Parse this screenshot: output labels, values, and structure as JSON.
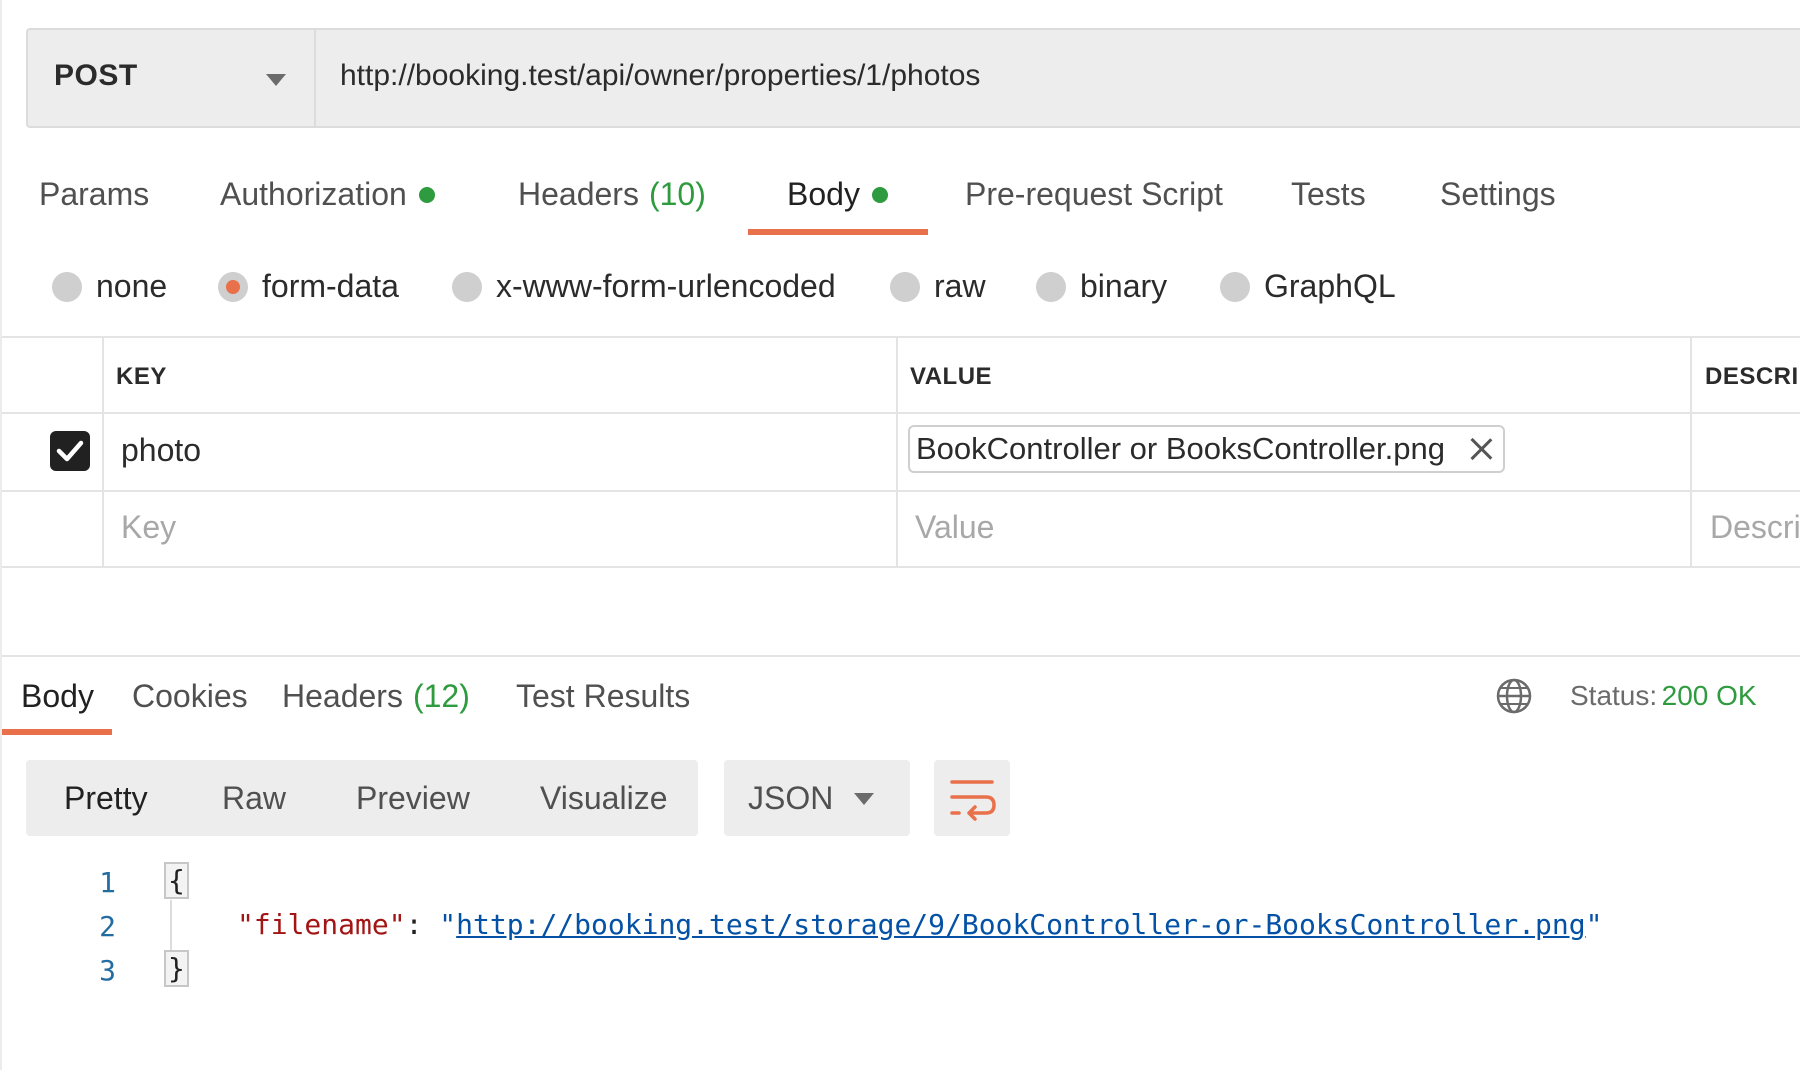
{
  "request": {
    "method": "POST",
    "url": "http://booking.test/api/owner/properties/1/photos"
  },
  "request_tabs": [
    {
      "label": "Params"
    },
    {
      "label": "Authorization",
      "dot": true
    },
    {
      "label": "Headers",
      "count": "(10)"
    },
    {
      "label": "Body",
      "dot": true,
      "active": true
    },
    {
      "label": "Pre-request Script"
    },
    {
      "label": "Tests"
    },
    {
      "label": "Settings"
    }
  ],
  "body_types": [
    {
      "label": "none"
    },
    {
      "label": "form-data",
      "checked": true
    },
    {
      "label": "x-www-form-urlencoded"
    },
    {
      "label": "raw"
    },
    {
      "label": "binary"
    },
    {
      "label": "GraphQL"
    }
  ],
  "params_table": {
    "headers": {
      "key": "KEY",
      "value": "VALUE",
      "description": "DESCRIPTION"
    },
    "rows": [
      {
        "checked": true,
        "key": "photo",
        "value_file": "BookController or BooksController.png"
      }
    ],
    "new_row": {
      "key_placeholder": "Key",
      "value_placeholder": "Value",
      "description_placeholder": "Description"
    }
  },
  "response_tabs": [
    {
      "label": "Body",
      "active": true
    },
    {
      "label": "Cookies"
    },
    {
      "label": "Headers",
      "count": "(12)"
    },
    {
      "label": "Test Results"
    }
  ],
  "status": {
    "label": "Status:",
    "value": "200 OK",
    "icon": "globe-icon"
  },
  "view_modes": [
    {
      "label": "Pretty",
      "active": true
    },
    {
      "label": "Raw"
    },
    {
      "label": "Preview"
    },
    {
      "label": "Visualize"
    }
  ],
  "format": {
    "selected": "JSON"
  },
  "wrap_icon": "wrap-lines-icon",
  "code": {
    "line_numbers": [
      "1",
      "2",
      "3"
    ],
    "open_brace": "{",
    "close_brace": "}",
    "key": "\"filename\"",
    "colon": ": ",
    "quote_open": "\"",
    "url": "http://booking.test/storage/9/BookController-or-BooksController.png",
    "quote_close": "\""
  },
  "colors": {
    "accent": "#e8704a",
    "success": "#2e9b3f",
    "json_key": "#a31515",
    "json_string": "#0451a5"
  }
}
